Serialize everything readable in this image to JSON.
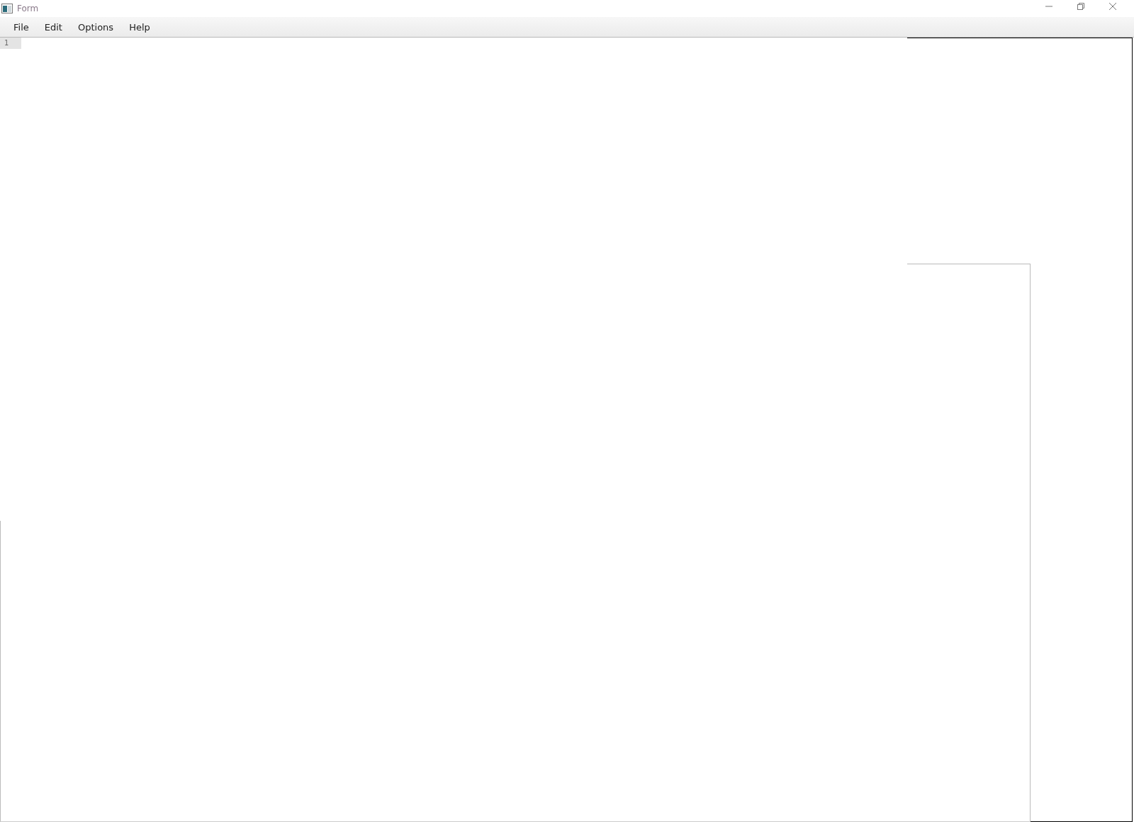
{
  "window": {
    "title": "Form"
  },
  "menu": [
    {
      "label": "File"
    },
    {
      "label": "Edit"
    },
    {
      "label": "Options"
    },
    {
      "label": "Help"
    }
  ],
  "editor": {
    "line_numbers": [
      "1"
    ]
  }
}
